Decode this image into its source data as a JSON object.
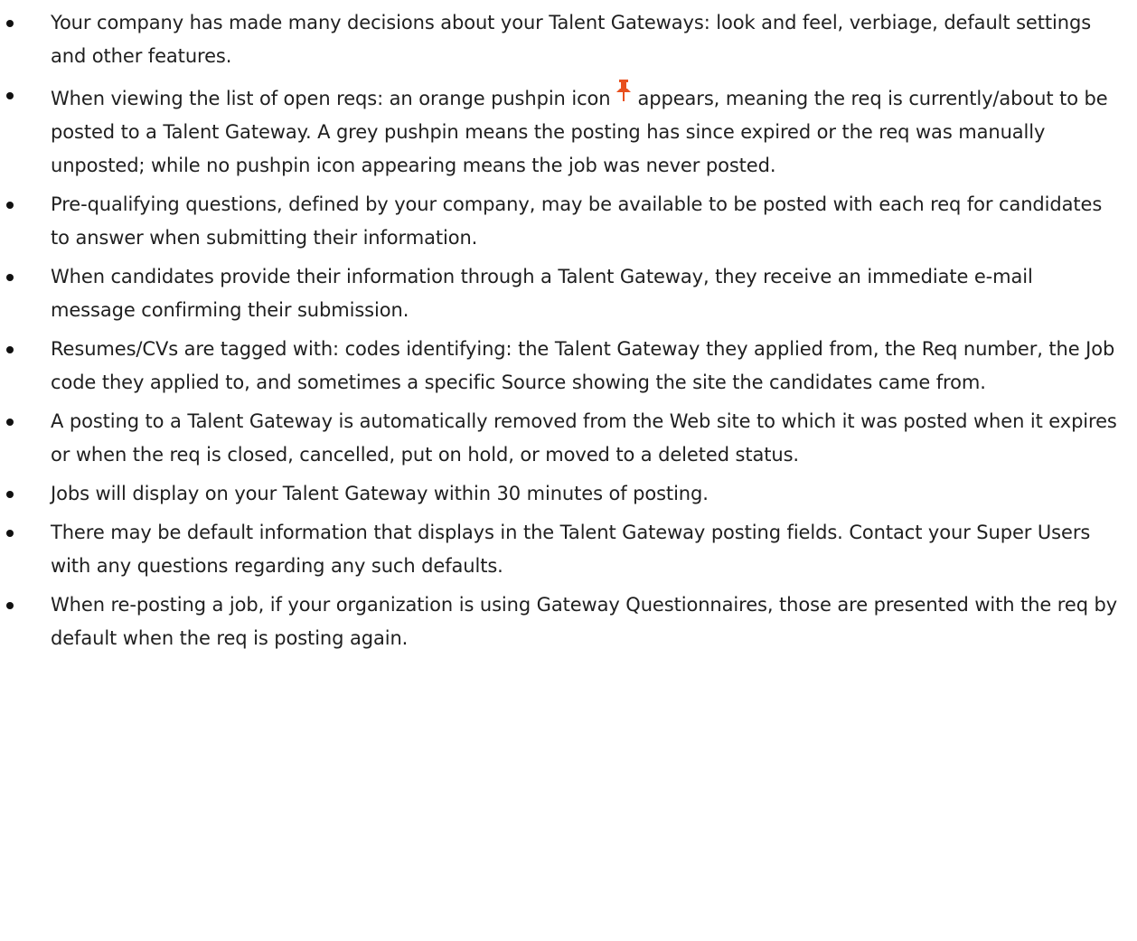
{
  "bullets": [
    {
      "text": "Your company has made many decisions about your Talent Gateways: look and feel, verbiage, default settings and other features."
    },
    {
      "text_before_icon": "When viewing the list of open reqs: an orange pushpin icon",
      "icon": "pushpin-icon",
      "icon_color": "#e8501e",
      "text_after_icon": "appears, meaning the req is currently/about to be posted to a Talent Gateway. A grey pushpin means the posting has since expired or the req was manually unposted; while no pushpin icon appearing means the job was never posted."
    },
    {
      "text": "Pre-qualifying questions, defined by your company, may be available to be posted with each req for candidates to answer when submitting their information."
    },
    {
      "text": "When candidates provide their information through a Talent Gateway, they receive an immediate e-mail message confirming their submission."
    },
    {
      "text": "Resumes/CVs are tagged with: codes identifying: the Talent Gateway they applied from, the Req number, the Job code they applied to, and sometimes a specific Source showing the site the candidates came from."
    },
    {
      "text": "A posting to a Talent Gateway is automatically removed from the Web site to which it was posted when it expires or when the req is closed, cancelled, put on hold, or moved to a deleted status."
    },
    {
      "text": "Jobs will display on your Talent Gateway within 30 minutes of posting."
    },
    {
      "text": "There may be default information that displays in the Talent Gateway posting fields. Contact your Super Users with any questions regarding any such defaults."
    },
    {
      "text": "When re-posting a job, if your organization is using Gateway Questionnaires, those are presented with the req by default when the req is posting again."
    }
  ]
}
